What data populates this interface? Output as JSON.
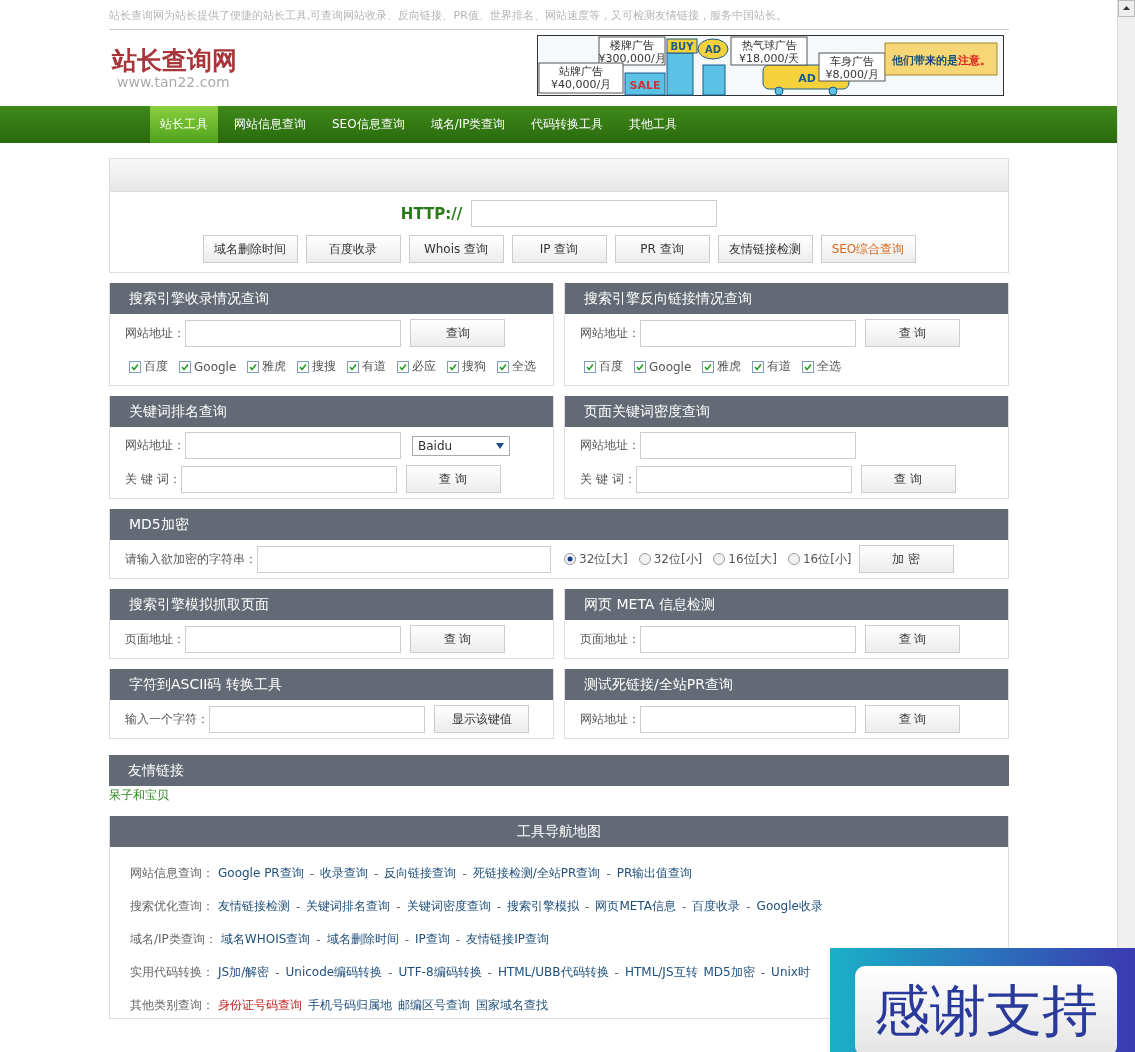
{
  "tagline": "站长查询网为站长提供了便捷的站长工具,可查询网站收录、反向链接、PR值、世界排名、网站速度等，又可检测友情链接，服务中国站长。",
  "logo": {
    "title": "站长查询网",
    "url": "www.tan22.com"
  },
  "ad": {
    "callouts": [
      [
        "楼牌广告",
        "¥300,000/月"
      ],
      [
        "热气球广告",
        "¥18,000/天"
      ],
      [
        "车身广告",
        "¥8,000/月"
      ],
      [
        "站牌广告",
        "¥40,000/月"
      ]
    ],
    "signs": [
      "BUY",
      "AD",
      "AD",
      "SALE"
    ],
    "slogan": [
      "他们带来的是",
      "注意。"
    ]
  },
  "nav": [
    {
      "label": "站长工具",
      "selected": true
    },
    {
      "label": "网站信息查询",
      "selected": false
    },
    {
      "label": "SEO信息查询",
      "selected": false
    },
    {
      "label": "域名/IP类查询",
      "selected": false
    },
    {
      "label": "代码转换工具",
      "selected": false
    },
    {
      "label": "其他工具",
      "selected": false
    }
  ],
  "main": {
    "prefix": "HTTP://",
    "buttons": [
      {
        "label": "域名删除时间",
        "kind": "normal"
      },
      {
        "label": "百度收录",
        "kind": "normal"
      },
      {
        "label": "Whois 查询",
        "kind": "normal"
      },
      {
        "label": "IP 查询",
        "kind": "normal"
      },
      {
        "label": "PR 查询",
        "kind": "normal"
      },
      {
        "label": "友情链接检测",
        "kind": "normal"
      },
      {
        "label": "SEO综合查询",
        "kind": "accent"
      }
    ]
  },
  "panel_rows": [
    {
      "panels": [
        {
          "title": "搜索引擎收录情况查询",
          "rows": [
            {
              "items": [
                {
                  "kind": "label",
                  "text": "网站地址："
                },
                {
                  "kind": "input"
                },
                {
                  "kind": "button",
                  "label": "查询"
                }
              ]
            },
            {
              "items": [
                {
                  "kind": "checkbox",
                  "label": "百度",
                  "checked": true
                },
                {
                  "kind": "checkbox",
                  "label": "Google",
                  "checked": true
                },
                {
                  "kind": "checkbox",
                  "label": "雅虎",
                  "checked": true
                },
                {
                  "kind": "checkbox",
                  "label": "搜搜",
                  "checked": true
                },
                {
                  "kind": "checkbox",
                  "label": "有道",
                  "checked": true
                },
                {
                  "kind": "checkbox",
                  "label": "必应",
                  "checked": true
                },
                {
                  "kind": "checkbox",
                  "label": "搜狗",
                  "checked": true
                },
                {
                  "kind": "checkbox",
                  "label": "全选",
                  "checked": true
                }
              ]
            }
          ]
        },
        {
          "title": "搜索引擎反向链接情况查询",
          "rows": [
            {
              "items": [
                {
                  "kind": "label",
                  "text": "网站地址："
                },
                {
                  "kind": "input"
                },
                {
                  "kind": "button",
                  "label": "查 询"
                }
              ]
            },
            {
              "items": [
                {
                  "kind": "checkbox",
                  "label": "百度",
                  "checked": true
                },
                {
                  "kind": "checkbox",
                  "label": "Google",
                  "checked": true
                },
                {
                  "kind": "checkbox",
                  "label": "雅虎",
                  "checked": true
                },
                {
                  "kind": "checkbox",
                  "label": "有道",
                  "checked": true
                },
                {
                  "kind": "checkbox",
                  "label": "全选",
                  "checked": true
                }
              ]
            }
          ]
        }
      ]
    },
    {
      "panels": [
        {
          "title": "关键词排名查询",
          "rows": [
            {
              "items": [
                {
                  "kind": "label",
                  "text": "网站地址："
                },
                {
                  "kind": "input"
                },
                {
                  "kind": "select",
                  "value": "Baidu"
                }
              ]
            },
            {
              "items": [
                {
                  "kind": "label",
                  "text": "关 键 词："
                },
                {
                  "kind": "input"
                },
                {
                  "kind": "button",
                  "label": "查 询"
                }
              ]
            }
          ]
        },
        {
          "title": "页面关键词密度查询",
          "rows": [
            {
              "items": [
                {
                  "kind": "label",
                  "text": "网站地址："
                },
                {
                  "kind": "input"
                }
              ]
            },
            {
              "items": [
                {
                  "kind": "label",
                  "text": "关 键 词："
                },
                {
                  "kind": "input"
                },
                {
                  "kind": "button",
                  "label": "查 询"
                }
              ]
            }
          ]
        }
      ]
    },
    {
      "panels": [
        {
          "title": "MD5加密",
          "rows": [
            {
              "items": [
                {
                  "kind": "label",
                  "text": "请输入欲加密的字符串："
                },
                {
                  "kind": "input"
                },
                {
                  "kind": "radio",
                  "label": "32位[大]",
                  "selected": true
                },
                {
                  "kind": "radio",
                  "label": "32位[小]",
                  "selected": false
                },
                {
                  "kind": "radio",
                  "label": "16位[大]",
                  "selected": false
                },
                {
                  "kind": "radio",
                  "label": "16位[小]",
                  "selected": false
                },
                {
                  "kind": "button",
                  "label": "加 密"
                }
              ]
            }
          ]
        }
      ]
    },
    {
      "panels": [
        {
          "title": "搜索引擎模拟抓取页面",
          "rows": [
            {
              "items": [
                {
                  "kind": "label",
                  "text": "页面地址："
                },
                {
                  "kind": "input"
                },
                {
                  "kind": "button",
                  "label": "查 询"
                }
              ]
            }
          ]
        },
        {
          "title": "网页  META 信息检测",
          "rows": [
            {
              "items": [
                {
                  "kind": "label",
                  "text": "页面地址："
                },
                {
                  "kind": "input"
                },
                {
                  "kind": "button",
                  "label": "查 询"
                }
              ]
            }
          ]
        }
      ]
    },
    {
      "panels": [
        {
          "title": "字符到ASCII码 转换工具",
          "rows": [
            {
              "items": [
                {
                  "kind": "label",
                  "text": "输入一个字符："
                },
                {
                  "kind": "input"
                },
                {
                  "kind": "button",
                  "label": "显示该键值"
                }
              ]
            }
          ]
        },
        {
          "title": "测试死链接/全站PR查询",
          "rows": [
            {
              "items": [
                {
                  "kind": "label",
                  "text": "网站地址："
                },
                {
                  "kind": "input"
                },
                {
                  "kind": "button",
                  "label": "查 询"
                }
              ]
            }
          ]
        }
      ]
    }
  ],
  "friend_links": {
    "title": "友情链接",
    "links": [
      "呆子和宝贝"
    ]
  },
  "sitemap": {
    "title": "工具导航地图",
    "rows": [
      {
        "label": "网站信息查询：",
        "items": [
          {
            "kind": "link",
            "text": "Google PR查询"
          },
          {
            "kind": "sep",
            "text": "-"
          },
          {
            "kind": "link",
            "text": "收录查询"
          },
          {
            "kind": "sep",
            "text": "-"
          },
          {
            "kind": "link",
            "text": "反向链接查询"
          },
          {
            "kind": "sep",
            "text": "-"
          },
          {
            "kind": "link",
            "text": "死链接检测/全站PR查询"
          },
          {
            "kind": "sep",
            "text": "-"
          },
          {
            "kind": "link",
            "text": "PR输出值查询"
          }
        ]
      },
      {
        "label": "搜索优化查询：",
        "items": [
          {
            "kind": "link",
            "text": "友情链接检测"
          },
          {
            "kind": "sep",
            "text": "-"
          },
          {
            "kind": "link",
            "text": "关键词排名查询"
          },
          {
            "kind": "sep",
            "text": "-"
          },
          {
            "kind": "link",
            "text": "关键词密度查询"
          },
          {
            "kind": "sep",
            "text": "-"
          },
          {
            "kind": "link",
            "text": "搜索引擎模拟"
          },
          {
            "kind": "sep",
            "text": "-"
          },
          {
            "kind": "link",
            "text": "网页META信息"
          },
          {
            "kind": "sep",
            "text": "-"
          },
          {
            "kind": "link",
            "text": "百度收录"
          },
          {
            "kind": "sep",
            "text": "-"
          },
          {
            "kind": "link",
            "text": "Google收录"
          }
        ]
      },
      {
        "label": "域名/IP类查询：",
        "items": [
          {
            "kind": "link",
            "text": "域名WHOIS查询"
          },
          {
            "kind": "sep",
            "text": "-"
          },
          {
            "kind": "link",
            "text": "域名删除时间"
          },
          {
            "kind": "sep",
            "text": "-"
          },
          {
            "kind": "link",
            "text": "IP查询"
          },
          {
            "kind": "sep",
            "text": "-"
          },
          {
            "kind": "link",
            "text": "友情链接IP查询"
          }
        ]
      },
      {
        "label": "实用代码转换：",
        "items": [
          {
            "kind": "link",
            "text": "JS加/解密"
          },
          {
            "kind": "sep",
            "text": "-"
          },
          {
            "kind": "link",
            "text": "Unicode编码转换"
          },
          {
            "kind": "sep",
            "text": "-"
          },
          {
            "kind": "link",
            "text": "UTF-8编码转换"
          },
          {
            "kind": "sep",
            "text": "-"
          },
          {
            "kind": "link",
            "text": "HTML/UBB代码转换"
          },
          {
            "kind": "sep",
            "text": "-"
          },
          {
            "kind": "link",
            "text": "HTML/JS互转"
          },
          {
            "kind": "link",
            "text": "MD5加密"
          },
          {
            "kind": "sep",
            "text": "-"
          },
          {
            "kind": "link",
            "text": "Unix时"
          }
        ]
      },
      {
        "label": "其他类别查询：",
        "items": [
          {
            "kind": "hot",
            "text": "身份证号码查询"
          },
          {
            "kind": "link",
            "text": "手机号码归属地"
          },
          {
            "kind": "link",
            "text": "邮编区号查询"
          },
          {
            "kind": "link",
            "text": "国家域名查找"
          }
        ]
      }
    ]
  },
  "float_banner": {
    "text": "感谢支持"
  }
}
